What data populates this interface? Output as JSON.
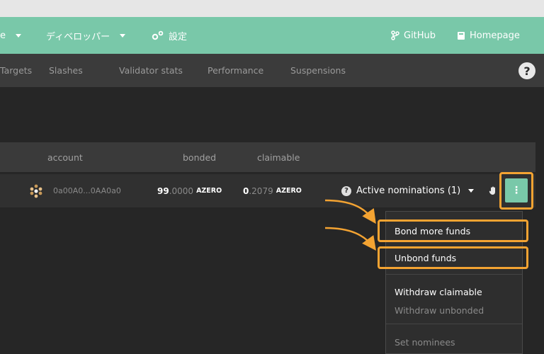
{
  "topbar": {
    "left_fragment": "e",
    "developer_label": "ディベロッパー",
    "settings_label": "設定",
    "github_label": "GitHub",
    "homepage_label": "Homepage"
  },
  "subnav": {
    "tabs": [
      "Targets",
      "Slashes",
      "Validator stats",
      "Performance",
      "Suspensions"
    ],
    "help": "?"
  },
  "table": {
    "headers": {
      "account": "account",
      "bonded": "bonded",
      "claimable": "claimable"
    },
    "row": {
      "address": "0a00A0...0AA0a0",
      "bonded_int": "99",
      "bonded_dec": ".0000",
      "bonded_unit": "AZERO",
      "claimable_int": "0",
      "claimable_dec": ".2079",
      "claimable_unit": "AZERO",
      "nominations_label": "Active nominations (1)",
      "menu_glyph": "⋮"
    }
  },
  "dropdown": {
    "bond_more": "Bond more funds",
    "unbond": "Unbond funds",
    "withdraw_claimable": "Withdraw claimable",
    "withdraw_unbonded": "Withdraw unbonded",
    "set_nominees": "Set nominees"
  },
  "colors": {
    "accent": "#79c8a9",
    "highlight": "#f3a332",
    "background": "#262626"
  }
}
